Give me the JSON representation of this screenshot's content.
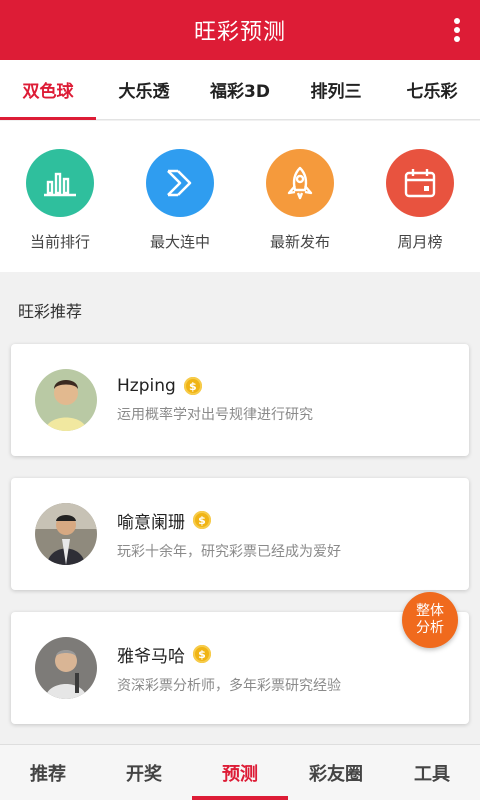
{
  "header": {
    "title": "旺彩预测",
    "menu_icon": "more-vertical-icon"
  },
  "tabs": [
    {
      "label": "双色球",
      "active": true
    },
    {
      "label": "大乐透",
      "active": false
    },
    {
      "label": "福彩3D",
      "active": false
    },
    {
      "label": "排列三",
      "active": false
    },
    {
      "label": "七乐彩",
      "active": false
    }
  ],
  "quick_links": [
    {
      "label": "当前排行",
      "icon": "bar-chart-icon",
      "color": "#2fbf9d"
    },
    {
      "label": "最大连中",
      "icon": "chevrons-icon",
      "color": "#2f9df0"
    },
    {
      "label": "最新发布",
      "icon": "rocket-icon",
      "color": "#f59a3c"
    },
    {
      "label": "周月榜",
      "icon": "calendar-icon",
      "color": "#e8533f"
    }
  ],
  "section": {
    "title": "旺彩推荐"
  },
  "experts": [
    {
      "name": "Hzping",
      "badge": "$",
      "desc": "运用概率学对出号规律进行研究"
    },
    {
      "name": "喻意阑珊",
      "badge": "$",
      "desc": "玩彩十余年，研究彩票已经成为爱好"
    },
    {
      "name": "雅爷马哈",
      "badge": "$",
      "desc": "资深彩票分析师，多年彩票研究经验"
    }
  ],
  "fab": {
    "line1": "整体",
    "line2": "分析",
    "color": "#f06a1d"
  },
  "bottom_nav": [
    {
      "label": "推荐",
      "active": false
    },
    {
      "label": "开奖",
      "active": false
    },
    {
      "label": "预测",
      "active": true
    },
    {
      "label": "彩友圈",
      "active": false
    },
    {
      "label": "工具",
      "active": false
    }
  ],
  "theme": {
    "primary": "#dd1c36"
  }
}
